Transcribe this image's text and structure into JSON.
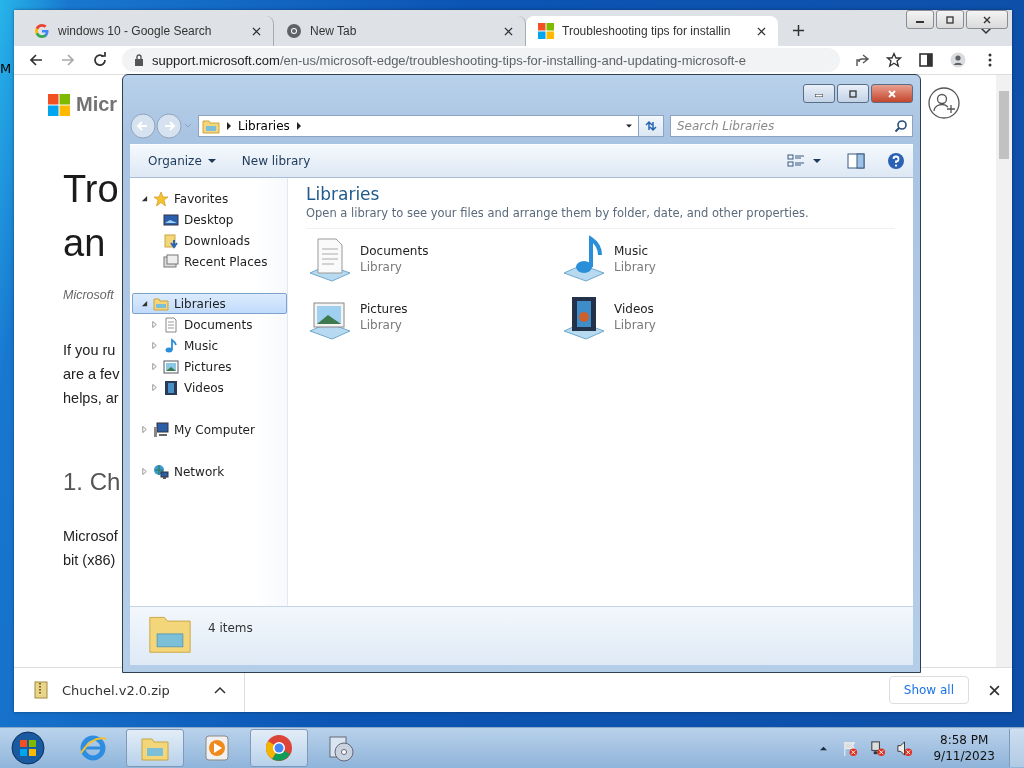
{
  "desktop": {
    "label": "M"
  },
  "browser": {
    "tabs": [
      {
        "title": "windows 10 - Google Search",
        "kind": "google",
        "selected": false
      },
      {
        "title": "New Tab",
        "kind": "chrome",
        "selected": false
      },
      {
        "title": "Troubleshooting tips for installin",
        "kind": "microsoft",
        "selected": true
      }
    ],
    "address": {
      "host": "support.microsoft.com",
      "path": "/en-us/microsoft-edge/troubleshooting-tips-for-installing-and-updating-microsoft-e"
    },
    "page": {
      "logo_text": "Micr",
      "heading_lines": [
        "Tro",
        "an"
      ],
      "byline": "Microsoft",
      "paragraph_lines": [
        "If you ru",
        "are a fev",
        "helps, ar"
      ],
      "section_heading": "1. Ch",
      "paragraph2_lines": [
        "Microsof",
        "bit (x86)"
      ]
    },
    "download": {
      "file": "Chuchel.v2.0.zip",
      "show_all": "Show all"
    }
  },
  "explorer": {
    "breadcrumb": "Libraries",
    "search_placeholder": "Search Libraries",
    "toolbar": [
      {
        "label": "Organize",
        "kind": "menu"
      },
      {
        "label": "New library",
        "kind": "plain"
      }
    ],
    "nav": [
      {
        "label": "Favorites",
        "kind": "star",
        "expanded": true,
        "selected": false,
        "children": [
          {
            "label": "Desktop",
            "kind": "desktop",
            "selected": false
          },
          {
            "label": "Downloads",
            "kind": "downloads",
            "selected": false
          },
          {
            "label": "Recent Places",
            "kind": "recent",
            "selected": false
          }
        ]
      },
      {
        "label": "Libraries",
        "kind": "library",
        "expanded": true,
        "selected": true,
        "children": [
          {
            "label": "Documents",
            "kind": "documents",
            "expanded": false,
            "selected": false
          },
          {
            "label": "Music",
            "kind": "music",
            "expanded": false,
            "selected": false
          },
          {
            "label": "Pictures",
            "kind": "pictures",
            "expanded": false,
            "selected": false
          },
          {
            "label": "Videos",
            "kind": "videos",
            "expanded": false,
            "selected": false
          }
        ]
      },
      {
        "label": "My Computer",
        "kind": "computer",
        "expanded": false,
        "selected": false
      },
      {
        "label": "Network",
        "kind": "network",
        "expanded": false,
        "selected": false
      }
    ],
    "heading": "Libraries",
    "subtitle": "Open a library to see your files and arrange them by folder, date, and other properties.",
    "libraries": [
      {
        "name": "Documents",
        "type": "Library",
        "kind": "documents"
      },
      {
        "name": "Music",
        "type": "Library",
        "kind": "music"
      },
      {
        "name": "Pictures",
        "type": "Library",
        "kind": "pictures"
      },
      {
        "name": "Videos",
        "type": "Library",
        "kind": "videos"
      }
    ],
    "status": "4 items"
  },
  "taskbar": {
    "apps": [
      {
        "kind": "ie",
        "active": false
      },
      {
        "kind": "explorer",
        "active": true
      },
      {
        "kind": "media",
        "active": false
      },
      {
        "kind": "chrome",
        "active": true
      },
      {
        "kind": "disc",
        "active": false
      }
    ],
    "time": "8:58 PM",
    "date": "9/11/2023"
  }
}
